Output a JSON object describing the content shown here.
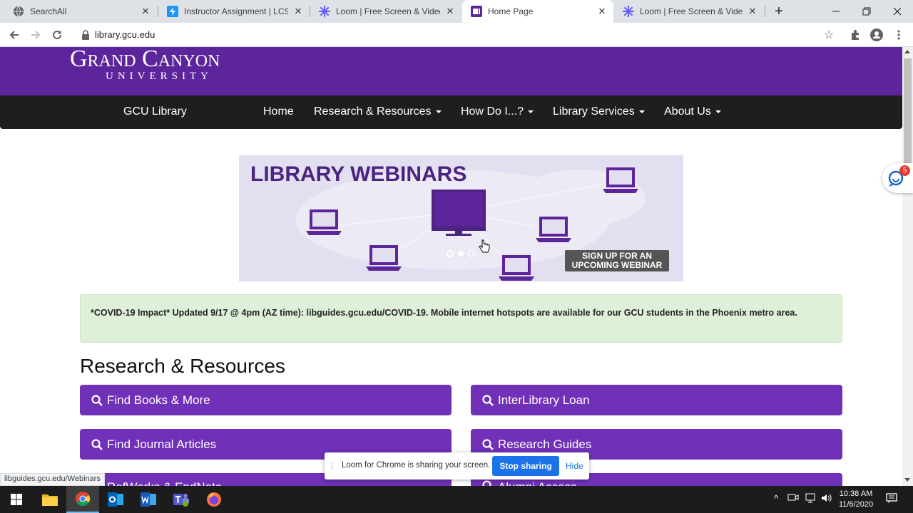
{
  "browser": {
    "tabs": [
      {
        "title": "SearchAll",
        "active": false
      },
      {
        "title": "Instructor Assignment | LCS Le",
        "active": false
      },
      {
        "title": "Loom | Free Screen & Video Re",
        "active": false
      },
      {
        "title": "Home Page",
        "active": true
      },
      {
        "title": "Loom | Free Screen & Video Re",
        "active": false
      }
    ],
    "url": "library.gcu.edu",
    "status_url": "libguides.gcu.edu/Webinars"
  },
  "site": {
    "logo_line1": "Grand Canyon",
    "logo_line2": "UNIVERSITY",
    "brand": "GCU Library",
    "nav": [
      {
        "label": "Home",
        "dropdown": false
      },
      {
        "label": "Research & Resources",
        "dropdown": true
      },
      {
        "label": "How Do I...?",
        "dropdown": true
      },
      {
        "label": "Library Services",
        "dropdown": true
      },
      {
        "label": "About Us",
        "dropdown": true
      }
    ],
    "banner": {
      "title": "LIBRARY WEBINARS",
      "cta_line1": "SIGN UP FOR AN",
      "cta_line2": "UPCOMING WEBINAR"
    },
    "alert": "*COVID-19 Impact* Updated 9/17 @ 4pm (AZ time): libguides.gcu.edu/COVID-19. Mobile internet hotspots are available for our GCU students in the Phoenix metro area.",
    "section_title": "Research & Resources",
    "resources": [
      {
        "label": "Find Books & More"
      },
      {
        "label": "InterLibrary Loan"
      },
      {
        "label": "Find Journal Articles"
      },
      {
        "label": "Research Guides"
      },
      {
        "label": "RefWorks & EndNote"
      },
      {
        "label": "Alumni Access"
      }
    ],
    "chat_badge": "5"
  },
  "loom": {
    "message": "Loom for Chrome is sharing your screen.",
    "stop_label": "Stop sharing",
    "hide_label": "Hide"
  },
  "taskbar": {
    "time": "10:38 AM",
    "date": "11/6/2020"
  },
  "colors": {
    "brand_purple": "#5d259b",
    "button_purple": "#7030b8",
    "navbar": "#1e1e1e",
    "alert_bg": "#dff0d8"
  }
}
